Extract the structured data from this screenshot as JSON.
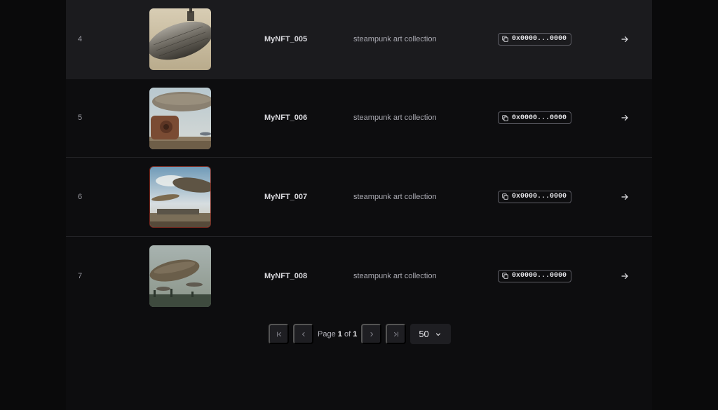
{
  "rows": [
    {
      "index": "4",
      "name": "MyNFT_005",
      "description": "steampunk art collection",
      "address": "0x0000...0000",
      "hovered": true
    },
    {
      "index": "5",
      "name": "MyNFT_006",
      "description": "steampunk art collection",
      "address": "0x0000...0000",
      "hovered": false
    },
    {
      "index": "6",
      "name": "MyNFT_007",
      "description": "steampunk art collection",
      "address": "0x0000...0000",
      "hovered": false
    },
    {
      "index": "7",
      "name": "MyNFT_008",
      "description": "steampunk art collection",
      "address": "0x0000...0000",
      "hovered": false
    }
  ],
  "pagination": {
    "page_prefix": "Page",
    "current_page": "1",
    "of_word": "of",
    "total_pages": "1",
    "page_size": "50"
  },
  "icons": {
    "first": "first-page-icon",
    "prev": "prev-page-icon",
    "next": "next-page-icon",
    "last": "last-page-icon",
    "copy": "copy-icon",
    "arrow": "arrow-right-icon",
    "dropdown": "chevron-down-icon"
  },
  "colors": {
    "background": "#0d0d0f",
    "row_hover": "#1b1b1e",
    "button": "#1e1e22",
    "border": "#5e5e66"
  }
}
